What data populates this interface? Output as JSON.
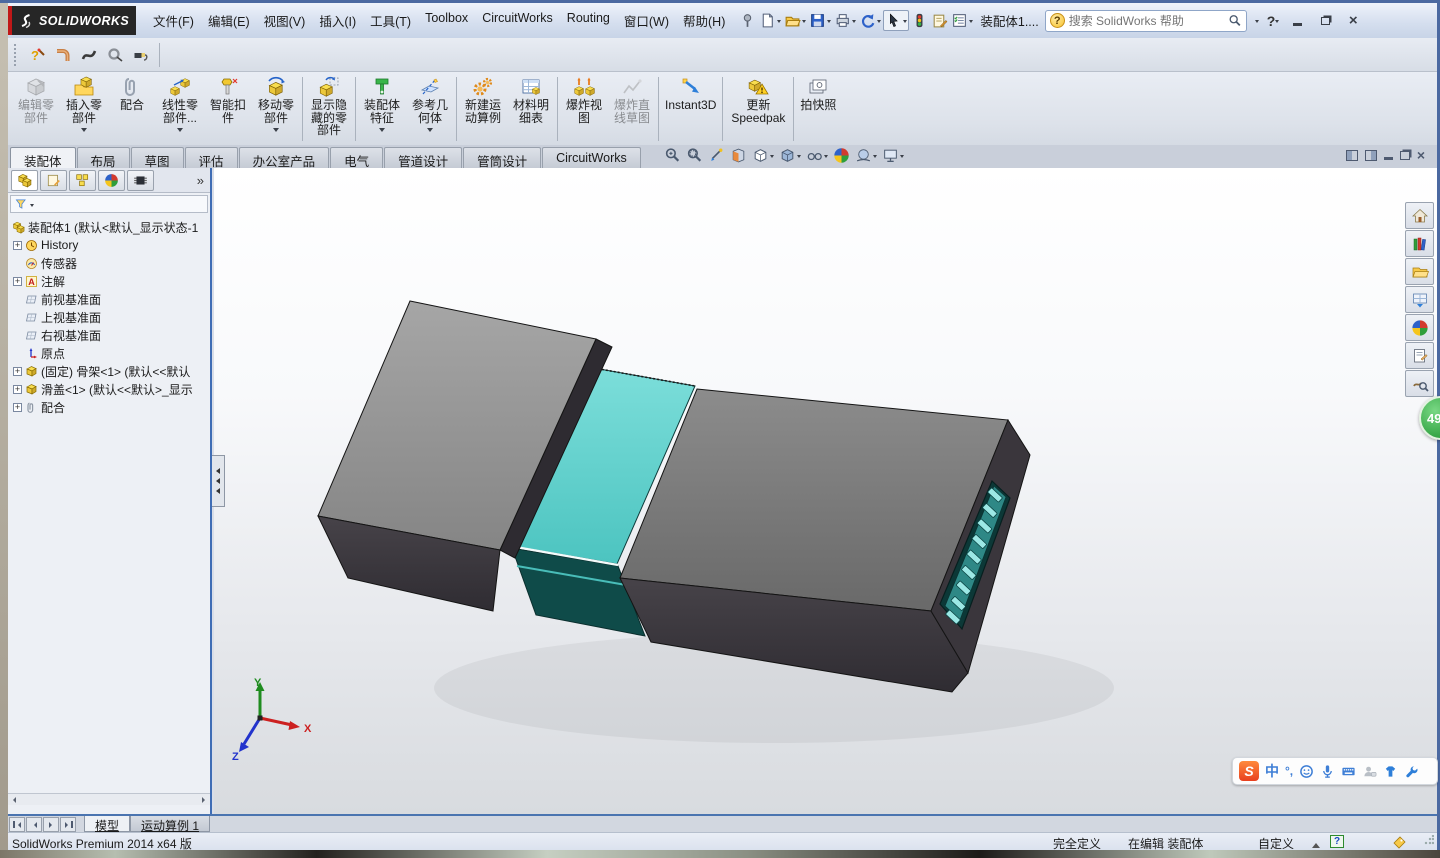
{
  "window": {
    "brand": "SOLIDWORKS",
    "doc_title": "装配体1....",
    "search_placeholder": "搜索 SolidWorks 帮助",
    "menus": [
      "文件(F)",
      "编辑(E)",
      "视图(V)",
      "插入(I)",
      "工具(T)",
      "Toolbox",
      "CircuitWorks",
      "Routing",
      "窗口(W)",
      "帮助(H)"
    ],
    "quick_access_icons": [
      "pin",
      "new-document",
      "open",
      "save",
      "print",
      "undo",
      "select",
      "rebuild",
      "file-properties",
      "options-list"
    ]
  },
  "routing_toolbar_icons": [
    "route-wizard",
    "pipe-route",
    "flexible-tube",
    "electrical-cable",
    "ribbon-cable"
  ],
  "ribbon": {
    "tabs": [
      "装配体",
      "布局",
      "草图",
      "评估",
      "办公室产品",
      "电气",
      "管道设计",
      "管筒设计",
      "CircuitWorks"
    ],
    "active_tab": "装配体",
    "buttons": [
      {
        "label": "编辑零部件",
        "disabled": true,
        "dropdown": false
      },
      {
        "label": "插入零部件",
        "disabled": false,
        "dropdown": true
      },
      {
        "label": "配合",
        "disabled": false,
        "dropdown": false
      },
      {
        "label": "线性零部件...",
        "disabled": false,
        "dropdown": true
      },
      {
        "label": "智能扣件",
        "disabled": false,
        "dropdown": false
      },
      {
        "label": "移动零部件",
        "disabled": false,
        "dropdown": true
      },
      {
        "label": "显示隐藏的零部件",
        "disabled": false,
        "dropdown": false
      },
      {
        "label": "装配体特征",
        "disabled": false,
        "dropdown": true
      },
      {
        "label": "参考几何体",
        "disabled": false,
        "dropdown": true
      },
      {
        "label": "新建运动算例",
        "disabled": false,
        "dropdown": false
      },
      {
        "label": "材料明细表",
        "disabled": false,
        "dropdown": false
      },
      {
        "label": "爆炸视图",
        "disabled": false,
        "dropdown": false
      },
      {
        "label": "爆炸直线草图",
        "disabled": true,
        "dropdown": false
      },
      {
        "label": "Instant3D",
        "disabled": false,
        "dropdown": false
      },
      {
        "label": "更新 Speedpak",
        "disabled": false,
        "dropdown": false
      },
      {
        "label": "拍快照",
        "disabled": false,
        "dropdown": false
      }
    ]
  },
  "headsup_icons": [
    "zoom-fit",
    "zoom-area",
    "previous-view",
    "section-view",
    "view-orientation",
    "display-style",
    "hide-show-items",
    "edit-appearance",
    "apply-scene",
    "view-settings"
  ],
  "feature_tree": {
    "root_label": "装配体1 (默认<默认_显示状态-1",
    "items": [
      {
        "label": "History",
        "icon": "history",
        "expandable": true
      },
      {
        "label": "传感器",
        "icon": "sensors",
        "expandable": false
      },
      {
        "label": "注解",
        "icon": "annotations",
        "expandable": true
      },
      {
        "label": "前视基准面",
        "icon": "plane",
        "expandable": false
      },
      {
        "label": "上视基准面",
        "icon": "plane",
        "expandable": false
      },
      {
        "label": "右视基准面",
        "icon": "plane",
        "expandable": false
      },
      {
        "label": "原点",
        "icon": "origin",
        "expandable": false
      },
      {
        "label": "(固定) 骨架<1> (默认<<默认",
        "icon": "part",
        "expandable": true
      },
      {
        "label": "滑盖<1> (默认<<默认>_显示",
        "icon": "part",
        "expandable": true
      },
      {
        "label": "配合",
        "icon": "mates",
        "expandable": true
      }
    ]
  },
  "viewport": {
    "triad": {
      "x_label": "X",
      "y_label": "Y",
      "z_label": "Z"
    },
    "model_colors": {
      "cap_gray": "#949494",
      "body_gray": "#7a7a7a",
      "slider_teal": "#5fd0cc",
      "dark_faces": "#3a363c"
    }
  },
  "task_pane_icons": [
    "home",
    "design-library",
    "file-explorer",
    "view-palette",
    "appearances",
    "custom-properties",
    "document-manager"
  ],
  "overlay": {
    "badge": "49"
  },
  "ime_bar": {
    "logo": "S",
    "mode": "中",
    "punctuation": "°,",
    "icons": [
      "emoji",
      "voice",
      "keyboard",
      "account",
      "skin",
      "toolbox"
    ]
  },
  "doc_tabs": {
    "tabs": [
      "模型",
      "运动算例 1"
    ],
    "active": "模型"
  },
  "status_bar": {
    "product": "SolidWorks Premium 2014 x64 版",
    "constraint_status": "完全定义",
    "edit_status": "在编辑 装配体",
    "units": "自定义"
  }
}
